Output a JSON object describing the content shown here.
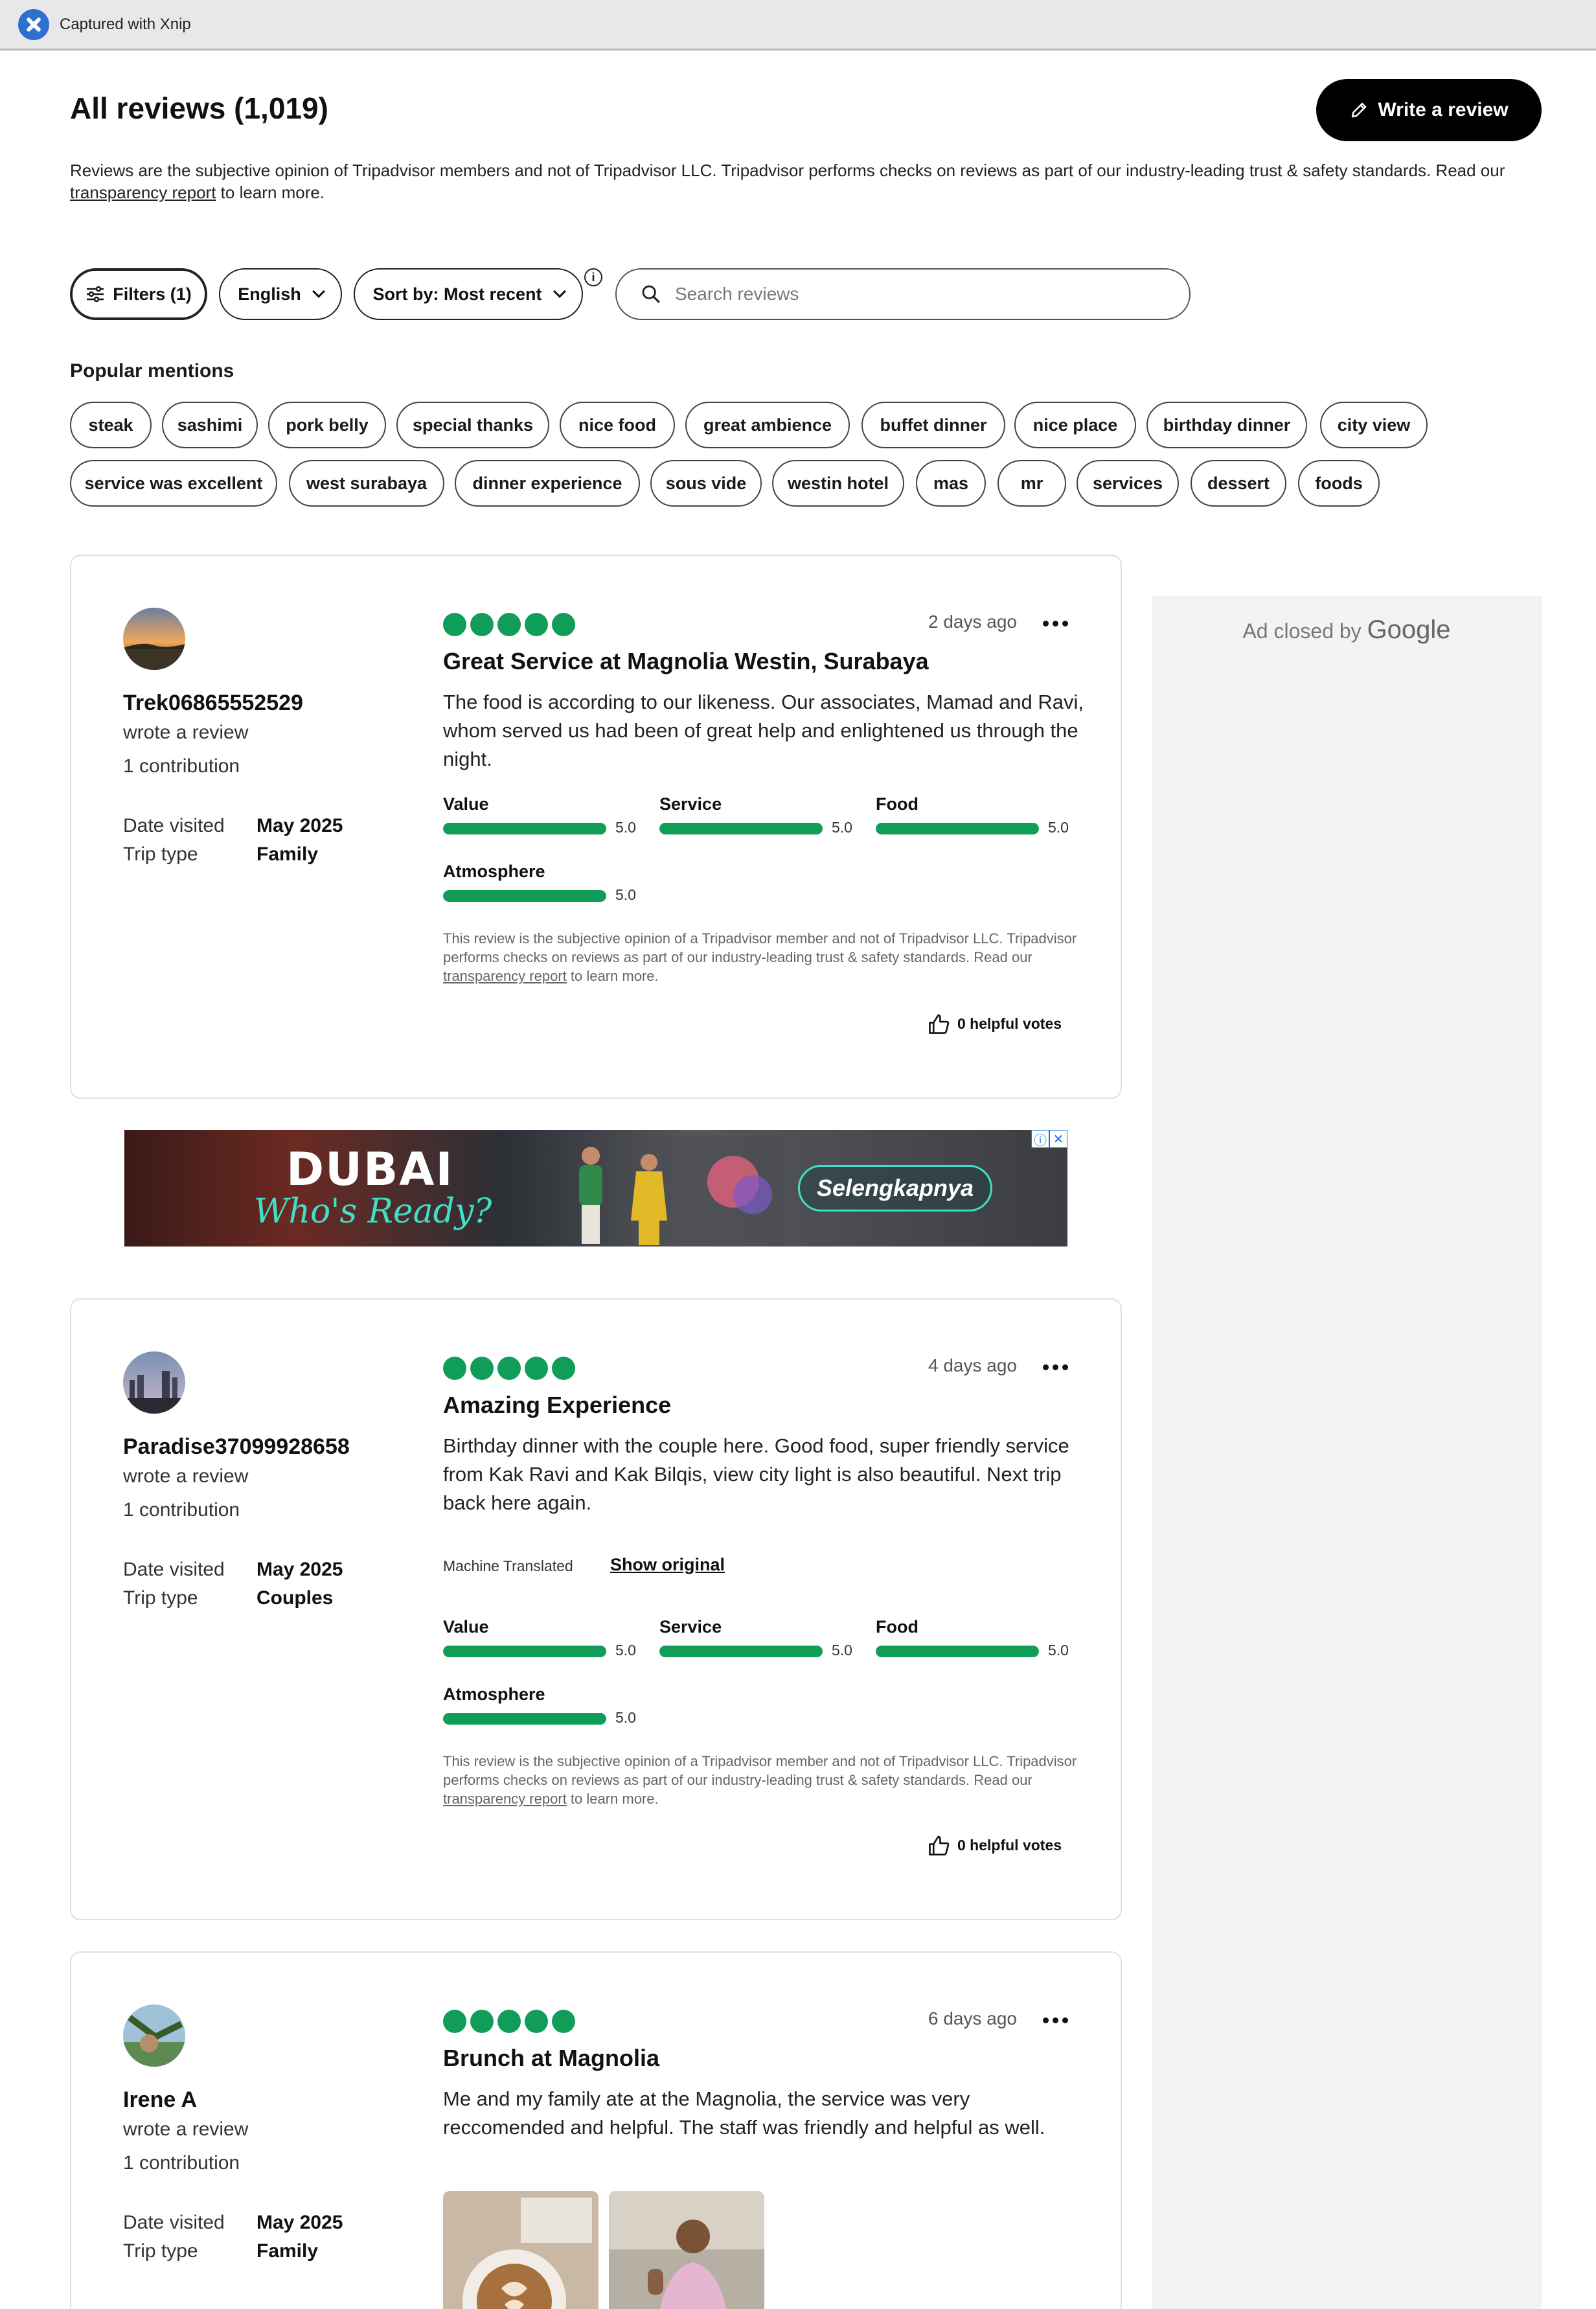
{
  "capture_bar": {
    "label": "Captured with Xnip"
  },
  "header": {
    "title": "All reviews (1,019)",
    "write_review": "Write a review",
    "disclaimer_pre": "Reviews are the subjective opinion of Tripadvisor members and not of Tripadvisor LLC. Tripadvisor performs checks on reviews as part of our industry-leading trust & safety standards. Read our ",
    "disclaimer_link": "transparency report",
    "disclaimer_post": " to learn more."
  },
  "filters": {
    "filters_label": "Filters (1)",
    "language": "English",
    "sort": "Sort by: Most recent",
    "info": "i",
    "search_placeholder": "Search reviews"
  },
  "popular_mentions": {
    "title": "Popular mentions",
    "row1": [
      "steak",
      "sashimi",
      "pork belly",
      "special thanks",
      "nice food",
      "great ambience",
      "buffet dinner",
      "nice place",
      "birthday dinner",
      "city view"
    ],
    "row2": [
      "service was excellent",
      "west surabaya",
      "dinner experience",
      "sous vide",
      "westin hotel",
      "mas",
      "mr",
      "services",
      "dessert",
      "foods"
    ]
  },
  "ad": {
    "closed_prefix": "Ad closed by",
    "closed_brand": "Google",
    "banner_headline": "DUBAI",
    "banner_tagline": "Who's Ready?",
    "banner_cta": "Selengkapnya"
  },
  "reviews": [
    {
      "username": "Trek06865552529",
      "wrote": "wrote a review",
      "contributions": "1 contribution",
      "date_visited_label": "Date visited",
      "date_visited": "May 2025",
      "trip_type_label": "Trip type",
      "trip_type": "Family",
      "rating": 5,
      "posted": "2 days ago",
      "title": "Great Service at Magnolia Westin, Surabaya",
      "body": "The food is according to our likeness. Our associates, Mamad and Ravi, whom served us had been of great help and enlightened us through the night.",
      "subratings": [
        {
          "label": "Value",
          "value": "5.0",
          "fraction": 1.0
        },
        {
          "label": "Service",
          "value": "5.0",
          "fraction": 1.0
        },
        {
          "label": "Food",
          "value": "5.0",
          "fraction": 1.0
        },
        {
          "label": "Atmosphere",
          "value": "5.0",
          "fraction": 1.0
        }
      ],
      "disclaimer_pre": "This review is the subjective opinion of a Tripadvisor member and not of Tripadvisor LLC. Tripadvisor performs checks on reviews as part of our industry-leading trust & safety standards. Read our ",
      "disclaimer_link": "transparency report",
      "disclaimer_post": " to learn more.",
      "helpful": "0 helpful votes"
    },
    {
      "username": "Paradise37099928658",
      "wrote": "wrote a review",
      "contributions": "1 contribution",
      "date_visited_label": "Date visited",
      "date_visited": "May 2025",
      "trip_type_label": "Trip type",
      "trip_type": "Couples",
      "rating": 5,
      "posted": "4 days ago",
      "title": "Amazing Experience",
      "body": "Birthday dinner with the couple here. Good food, super friendly service from Kak Ravi and Kak Bilqis, view city light is also beautiful. Next trip back here again.",
      "machine_translated": "Machine Translated",
      "show_original": "Show original",
      "subratings": [
        {
          "label": "Value",
          "value": "5.0",
          "fraction": 1.0
        },
        {
          "label": "Service",
          "value": "5.0",
          "fraction": 1.0
        },
        {
          "label": "Food",
          "value": "5.0",
          "fraction": 1.0
        },
        {
          "label": "Atmosphere",
          "value": "5.0",
          "fraction": 1.0
        }
      ],
      "disclaimer_pre": "This review is the subjective opinion of a Tripadvisor member and not of Tripadvisor LLC. Tripadvisor performs checks on reviews as part of our industry-leading trust & safety standards. Read our ",
      "disclaimer_link": "transparency report",
      "disclaimer_post": " to learn more.",
      "helpful": "0 helpful votes"
    },
    {
      "username": "Irene A",
      "wrote": "wrote a review",
      "contributions": "1 contribution",
      "date_visited_label": "Date visited",
      "date_visited": "May 2025",
      "trip_type_label": "Trip type",
      "trip_type": "Family",
      "rating": 5,
      "posted": "6 days ago",
      "title": "Brunch at Magnolia",
      "body": "Me and my family ate at the Magnolia, the service was very reccomended and helpful. The staff was friendly and helpful as well."
    }
  ]
}
